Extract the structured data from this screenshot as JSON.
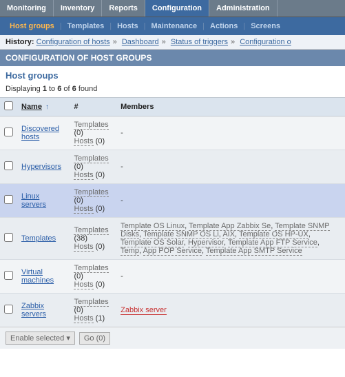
{
  "topnav": {
    "items": [
      "Monitoring",
      "Inventory",
      "Reports",
      "Configuration",
      "Administration"
    ],
    "active": 3
  },
  "subnav": {
    "items": [
      "Host groups",
      "Templates",
      "Hosts",
      "Maintenance",
      "Actions",
      "Screens"
    ],
    "active": 0
  },
  "history": {
    "label": "History:",
    "crumbs": [
      "Configuration of hosts",
      "Dashboard",
      "Status of triggers",
      "Configuration o"
    ]
  },
  "page_title": "CONFIGURATION OF HOST GROUPS",
  "section_heading": "Host groups",
  "displaying": {
    "prefix": "Displaying ",
    "from": "1",
    "mid": " to ",
    "to": "6",
    "of_word": " of ",
    "total": "6",
    "suffix": " found"
  },
  "columns": {
    "name": "Name",
    "hash": "#",
    "members": "Members"
  },
  "rows": [
    {
      "name": "Discovered hosts",
      "templates_label": "Templates",
      "templates_count": "(0)",
      "hosts_label": "Hosts",
      "hosts_count": "(0)",
      "members_text": "-"
    },
    {
      "name": "Hypervisors",
      "templates_label": "Templates",
      "templates_count": "(0)",
      "hosts_label": "Hosts",
      "hosts_count": "(0)",
      "members_text": "-"
    },
    {
      "name": "Linux servers",
      "templates_label": "Templates",
      "templates_count": "(0)",
      "hosts_label": "Hosts",
      "hosts_count": "(0)",
      "members_text": "-",
      "selected": true
    },
    {
      "name": "Templates",
      "templates_label": "Templates",
      "templates_count": "(38)",
      "hosts_label": "Hosts",
      "hosts_count": "(0)",
      "members_links": [
        "Template OS Linux",
        "Template App Zabbix Se",
        "Template SNMP Disks",
        "Template SNMP OS Li",
        "AIX",
        "Template OS HP-UX",
        "Template OS Solar",
        "Hypervisor",
        "Template App FTP Service",
        "Temp",
        "App POP Service",
        "Template App SMTP Service"
      ]
    },
    {
      "name": "Virtual machines",
      "templates_label": "Templates",
      "templates_count": "(0)",
      "hosts_label": "Hosts",
      "hosts_count": "(0)",
      "members_text": "-"
    },
    {
      "name": "Zabbix servers",
      "templates_label": "Templates",
      "templates_count": "(0)",
      "hosts_label": "Hosts",
      "hosts_count": "(1)",
      "members_red": "Zabbix server"
    }
  ],
  "footer": {
    "dropdown": "Enable selected ▾",
    "go": "Go (0)"
  }
}
